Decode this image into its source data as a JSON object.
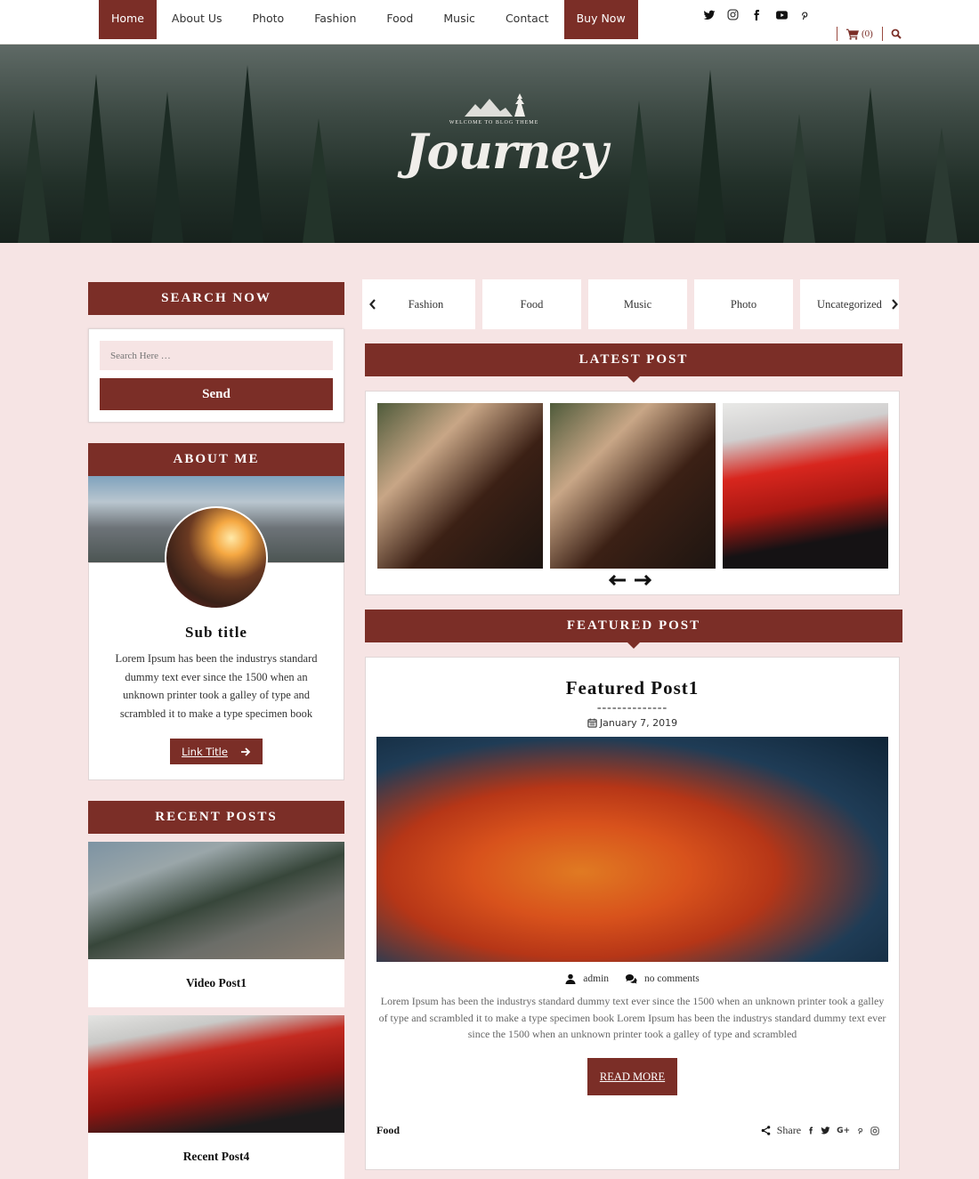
{
  "nav": {
    "items": [
      {
        "label": "Home",
        "active": true
      },
      {
        "label": "About Us"
      },
      {
        "label": "Photo"
      },
      {
        "label": "Fashion"
      },
      {
        "label": "Food"
      },
      {
        "label": "Music"
      },
      {
        "label": "Contact"
      }
    ],
    "buy_label": "Buy Now"
  },
  "social": [
    "twitter-icon",
    "instagram-icon",
    "facebook-icon",
    "youtube-icon",
    "pinterest-icon"
  ],
  "cart": {
    "count_text": "(0)"
  },
  "hero": {
    "tagline": "WELCOME TO BLOG THEME",
    "logo_text": "Journey"
  },
  "sidebar": {
    "search": {
      "title": "SEARCH NOW",
      "placeholder": "Search Here …",
      "button": "Send"
    },
    "about": {
      "title": "ABOUT ME",
      "subtitle": "Sub title",
      "text": "Lorem Ipsum has been the industrys standard dummy text ever since the 1500 when an unknown printer took a galley of type and scrambled it to make a type specimen book",
      "link_label": "Link Title"
    },
    "recent": {
      "title": "RECENT POSTS",
      "posts": [
        {
          "title": "Video Post1"
        },
        {
          "title": "Recent Post4"
        }
      ]
    }
  },
  "main": {
    "categories": [
      "Fashion",
      "Food",
      "Music",
      "Photo",
      "Uncategorized"
    ],
    "latest": {
      "title": "LATEST POST"
    },
    "featured": {
      "section_title": "FEATURED POST",
      "post_title": "Featured Post1",
      "divider": "--------------",
      "date": "January 7, 2019",
      "author": "admin",
      "comments": "no comments",
      "excerpt": "Lorem Ipsum has been the industrys standard dummy text ever since the 1500 when an unknown printer took a galley of type and scrambled it to make a type specimen book Lorem Ipsum has been the industrys standard dummy text ever since the 1500 when an unknown printer took a galley of type and scrambled",
      "read_more": "READ MORE",
      "category": "Food",
      "share_label": "Share"
    }
  },
  "colors": {
    "accent": "#7b2e27",
    "background": "#f6e4e4"
  }
}
